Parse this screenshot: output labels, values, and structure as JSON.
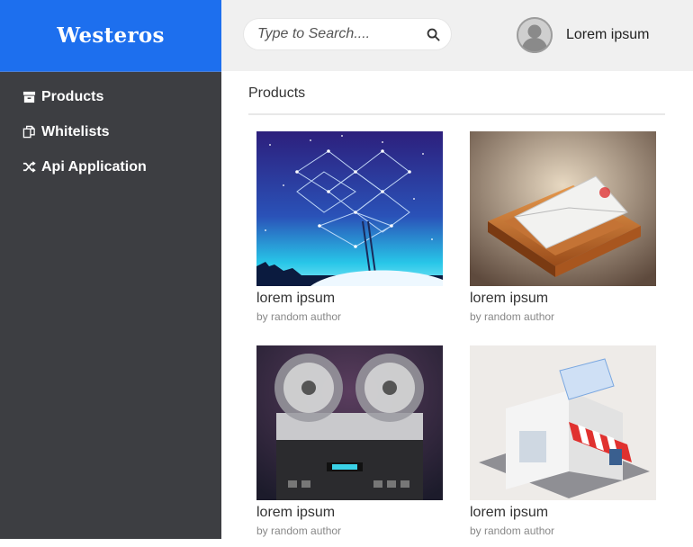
{
  "brand": {
    "name": "Westeros",
    "color": "#1d6fee"
  },
  "sidebar": {
    "items": [
      {
        "label": "Products",
        "icon": "archive-icon"
      },
      {
        "label": "Whitelists",
        "icon": "copy-icon"
      },
      {
        "label": "Api Application",
        "icon": "shuffle-icon"
      }
    ]
  },
  "search": {
    "placeholder": "Type to Search....",
    "icon": "search-icon"
  },
  "user": {
    "name": "Lorem ipsum",
    "avatar": "user-avatar-icon"
  },
  "main": {
    "section_title": "Products",
    "products": [
      {
        "title": "lorem ipsum",
        "author": "by random author",
        "image": "dropbox-starry-night"
      },
      {
        "title": "lorem ipsum",
        "author": "by random author",
        "image": "envelope-tray"
      },
      {
        "title": "lorem ipsum",
        "author": "by random author",
        "image": "reel-to-reel-tape-recorder"
      },
      {
        "title": "lorem ipsum",
        "author": "by random author",
        "image": "sweet-shop-building"
      }
    ]
  }
}
